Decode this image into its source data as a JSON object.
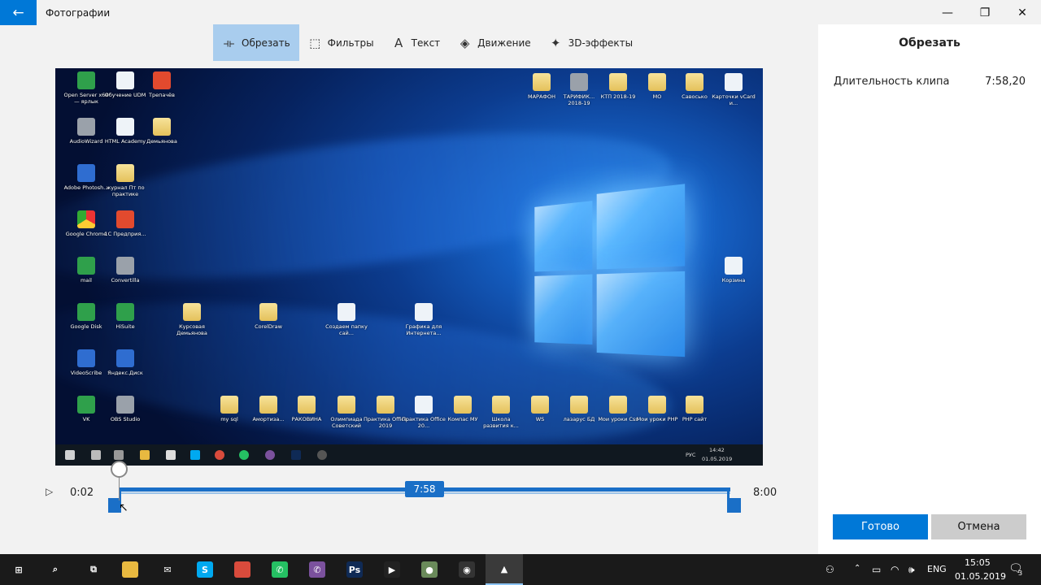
{
  "window": {
    "app_title": "Фотографии",
    "back_icon": "arrow-left-icon",
    "minimize_glyph": "—",
    "maximize_glyph": "❐",
    "close_glyph": "✕"
  },
  "toolbar": {
    "items": [
      {
        "label": "Обрезать",
        "icon": "trim-icon",
        "glyph": "⟛",
        "active": true
      },
      {
        "label": "Фильтры",
        "icon": "filter-icon",
        "glyph": "⬚",
        "active": false
      },
      {
        "label": "Текст",
        "icon": "text-icon",
        "glyph": "A",
        "active": false
      },
      {
        "label": "Движение",
        "icon": "motion-icon",
        "glyph": "◈",
        "active": false
      },
      {
        "label": "3D-эффекты",
        "icon": "effects-3d-icon",
        "glyph": "✦",
        "active": false
      }
    ]
  },
  "video": {
    "desktop_icons": [
      {
        "label": "Open Server x64 — ярлык",
        "style": "green"
      },
      {
        "label": "Обучение UDM",
        "style": "white"
      },
      {
        "label": "Трепачёв",
        "style": "red"
      },
      {
        "label": "AudioWizard",
        "style": "gray"
      },
      {
        "label": "HTML Academy",
        "style": "white"
      },
      {
        "label": "Демьянова",
        "style": "folder"
      },
      {
        "label": "Adobe Photosh...",
        "style": "blue"
      },
      {
        "label": "журнал Пт по практике",
        "style": "folder"
      },
      {
        "label": "Google Chrome",
        "style": "chrome"
      },
      {
        "label": "1С Предприя...",
        "style": "red"
      },
      {
        "label": "mail",
        "style": "green"
      },
      {
        "label": "Convertilla",
        "style": "gray"
      },
      {
        "label": "Google Disk",
        "style": "green"
      },
      {
        "label": "HiSuite",
        "style": "green"
      },
      {
        "label": "VideoScribe",
        "style": "blue"
      },
      {
        "label": "Яндекс.Диск",
        "style": "blue"
      },
      {
        "label": "VK",
        "style": "green"
      },
      {
        "label": "OBS Studio",
        "style": "gray"
      },
      {
        "label": "Курсовая Демьянова",
        "style": "folder"
      },
      {
        "label": "CorelDraw",
        "style": "folder"
      },
      {
        "label": "Создаем папку сай...",
        "style": "white"
      },
      {
        "label": "Графика для Интернета...",
        "style": "white"
      },
      {
        "label": "МАРАФОН",
        "style": "folder"
      },
      {
        "label": "ТАРИФИК... 2018-19",
        "style": "gray"
      },
      {
        "label": "КТП 2018-19",
        "style": "folder"
      },
      {
        "label": "МО",
        "style": "folder"
      },
      {
        "label": "Савосько",
        "style": "folder"
      },
      {
        "label": "Карточки vCard и...",
        "style": "white"
      },
      {
        "label": "Корзина",
        "style": "white"
      },
      {
        "label": "my sql",
        "style": "folder"
      },
      {
        "label": "Амортиза...",
        "style": "folder"
      },
      {
        "label": "РАКОВИНА",
        "style": "folder"
      },
      {
        "label": "Олимпиада Советский",
        "style": "folder"
      },
      {
        "label": "Практика Office 2019",
        "style": "folder"
      },
      {
        "label": "Практика Office 20...",
        "style": "white"
      },
      {
        "label": "Компас МУ",
        "style": "folder"
      },
      {
        "label": "Школа развития к...",
        "style": "folder"
      },
      {
        "label": "WS",
        "style": "folder"
      },
      {
        "label": "лазарус БД",
        "style": "folder"
      },
      {
        "label": "Мои уроки Css",
        "style": "folder"
      },
      {
        "label": "Мои уроки PHP",
        "style": "folder"
      },
      {
        "label": "PHP сайт",
        "style": "folder"
      }
    ],
    "taskbar": {
      "lang": "РУС",
      "time": "14:42",
      "date": "01.05.2019"
    }
  },
  "timeline": {
    "play_icon": "play-icon",
    "play_glyph": "▷",
    "start_time": "0:02",
    "end_time": "8:00",
    "clip_length_badge": "7:58",
    "start_fraction": 0.0042,
    "end_fraction": 1.0,
    "playhead_fraction": 0.0042
  },
  "panel": {
    "title": "Обрезать",
    "duration_label": "Длительность клипа",
    "duration_value": "7:58,20",
    "done_label": "Готово",
    "cancel_label": "Отмена"
  },
  "os_taskbar": {
    "apps": [
      {
        "icon": "windows-start-icon",
        "glyph": "⊞",
        "color": "#1a1a1a"
      },
      {
        "icon": "search-icon",
        "glyph": "⌕",
        "color": "#1a1a1a"
      },
      {
        "icon": "task-view-icon",
        "glyph": "⧉",
        "color": "#1a1a1a"
      },
      {
        "icon": "file-explorer-icon",
        "glyph": "",
        "color": "#e8b940"
      },
      {
        "icon": "mail-icon",
        "glyph": "✉",
        "color": "#1a1a1a"
      },
      {
        "icon": "skype-icon",
        "glyph": "S",
        "color": "#00a9f0"
      },
      {
        "icon": "chrome-icon",
        "glyph": "",
        "color": "#d94b3c"
      },
      {
        "icon": "whatsapp-icon",
        "glyph": "✆",
        "color": "#25c063"
      },
      {
        "icon": "viber-icon",
        "glyph": "✆",
        "color": "#7b519d"
      },
      {
        "icon": "photoshop-icon",
        "glyph": "Ps",
        "color": "#0f2a55"
      },
      {
        "icon": "video-editor-icon",
        "glyph": "▶",
        "color": "#222222"
      },
      {
        "icon": "palette-icon",
        "glyph": "●",
        "color": "#6a8a5a"
      },
      {
        "icon": "obs-icon",
        "glyph": "◉",
        "color": "#333333"
      },
      {
        "icon": "photos-icon",
        "glyph": "▲",
        "color": "#3a3a3a"
      }
    ],
    "lang": "ENG",
    "time": "15:05",
    "date": "01.05.2019",
    "notification_count": "3"
  }
}
